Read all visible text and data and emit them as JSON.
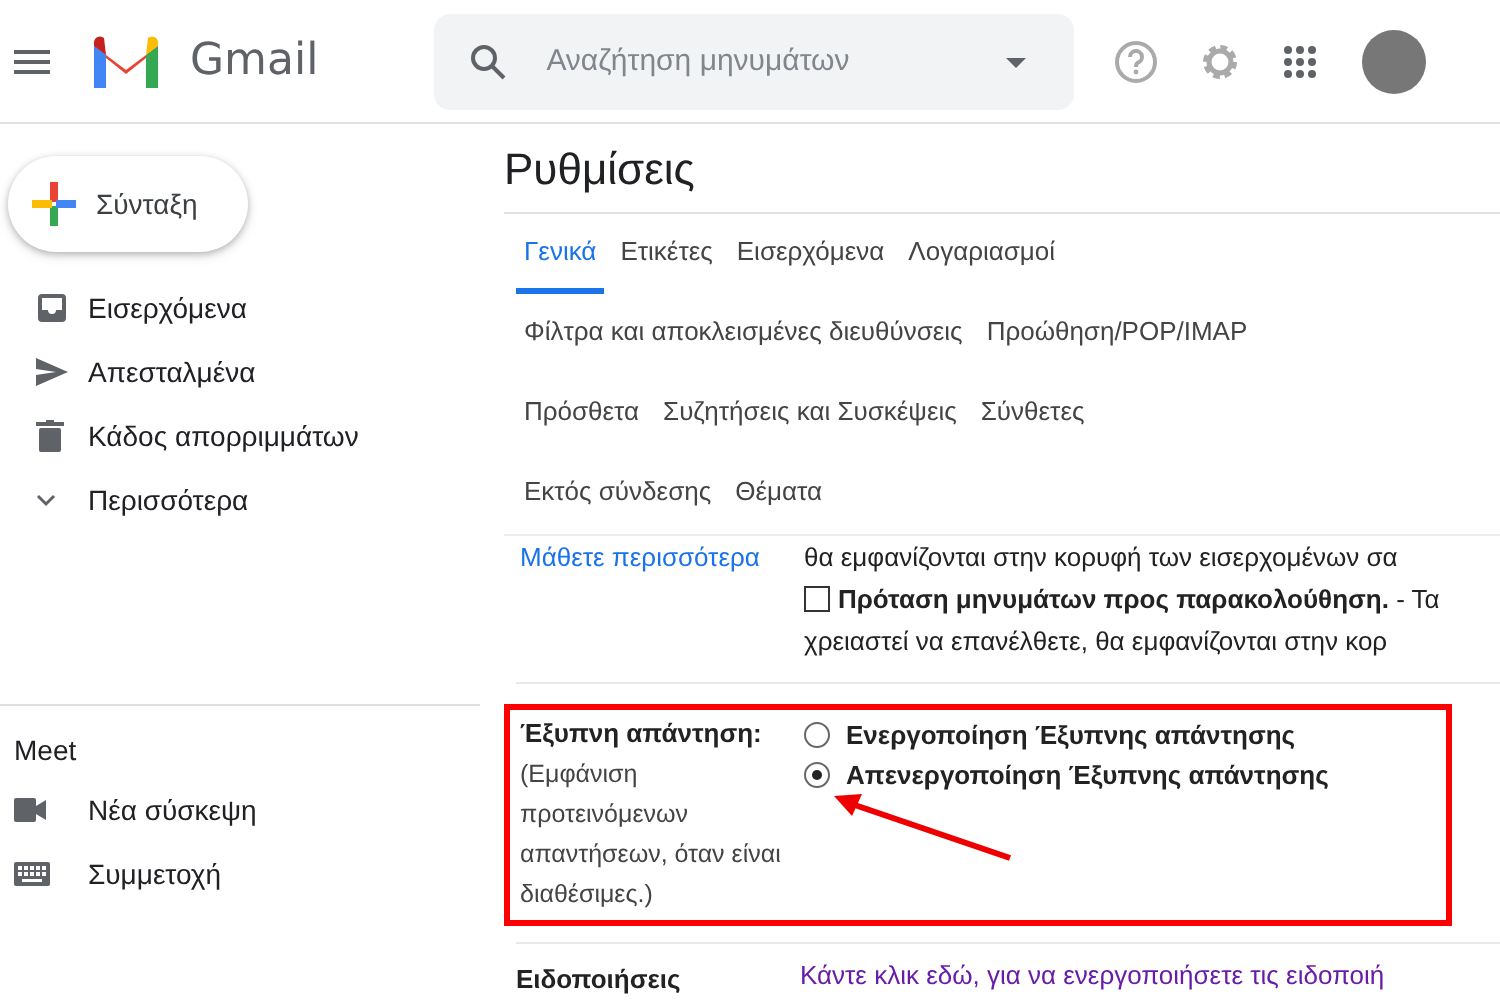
{
  "header": {
    "app_name": "Gmail",
    "search": {
      "placeholder": "Αναζήτηση μηνυμάτων"
    }
  },
  "compose": {
    "label": "Σύνταξη"
  },
  "sidebar": {
    "items": [
      {
        "label": "Εισερχόμενα",
        "kind": "inbox"
      },
      {
        "label": "Απεσταλμένα",
        "kind": "sent"
      },
      {
        "label": "Κάδος απορριμμάτων",
        "kind": "trash"
      },
      {
        "label": "Περισσότερα",
        "kind": "more"
      }
    ]
  },
  "meet": {
    "title": "Meet",
    "items": [
      {
        "label": "Νέα σύσκεψη",
        "kind": "video"
      },
      {
        "label": "Συμμετοχή",
        "kind": "keyboard"
      }
    ]
  },
  "settings": {
    "title": "Ρυθμίσεις",
    "tab_rows": [
      [
        {
          "label": "Γενικά",
          "selected": true
        },
        {
          "label": "Ετικέτες",
          "selected": false
        },
        {
          "label": "Εισερχόμενα",
          "selected": false
        },
        {
          "label": "Λογαριασμοί",
          "selected": false
        }
      ],
      [
        {
          "label": "Φίλτρα και αποκλεισμένες διευθύνσεις",
          "selected": false
        },
        {
          "label": "Προώθηση/POP/IMAP",
          "selected": false
        }
      ],
      [
        {
          "label": "Πρόσθετα",
          "selected": false
        },
        {
          "label": "Συζητήσεις και Συσκέψεις",
          "selected": false
        },
        {
          "label": "Σύνθετες",
          "selected": false
        }
      ],
      [
        {
          "label": "Εκτός σύνδεσης",
          "selected": false
        },
        {
          "label": "Θέματα",
          "selected": false
        }
      ]
    ],
    "partial_section": {
      "link": "Μάθετε περισσότερα",
      "line": "θα εμφανίζονται στην κορυφή των εισερχομένων σα",
      "checkbox": {
        "label": "Πρόταση μηνυμάτων προς παρακολούθηση.",
        "detail": "- Τα",
        "checked": false
      },
      "continuation": "χρειαστεί να επανέλθετε, θα εμφανίζονται στην κορ"
    },
    "smart_reply": {
      "label": "Έξυπνη απάντηση:",
      "description": "(Εμφάνιση προτεινόμενων απαντήσεων, όταν είναι διαθέσιμες.)",
      "options": [
        {
          "label": "Ενεργοποίηση Έξυπνης απάντησης",
          "selected": false
        },
        {
          "label": "Απενεργοποίηση Έξυπνης απάντησης",
          "selected": true
        }
      ]
    },
    "notifications": {
      "label": "Ειδοποιήσεις",
      "link": "Κάντε κλικ εδώ, για να ενεργοποιήσετε τις ειδοποιή"
    }
  }
}
